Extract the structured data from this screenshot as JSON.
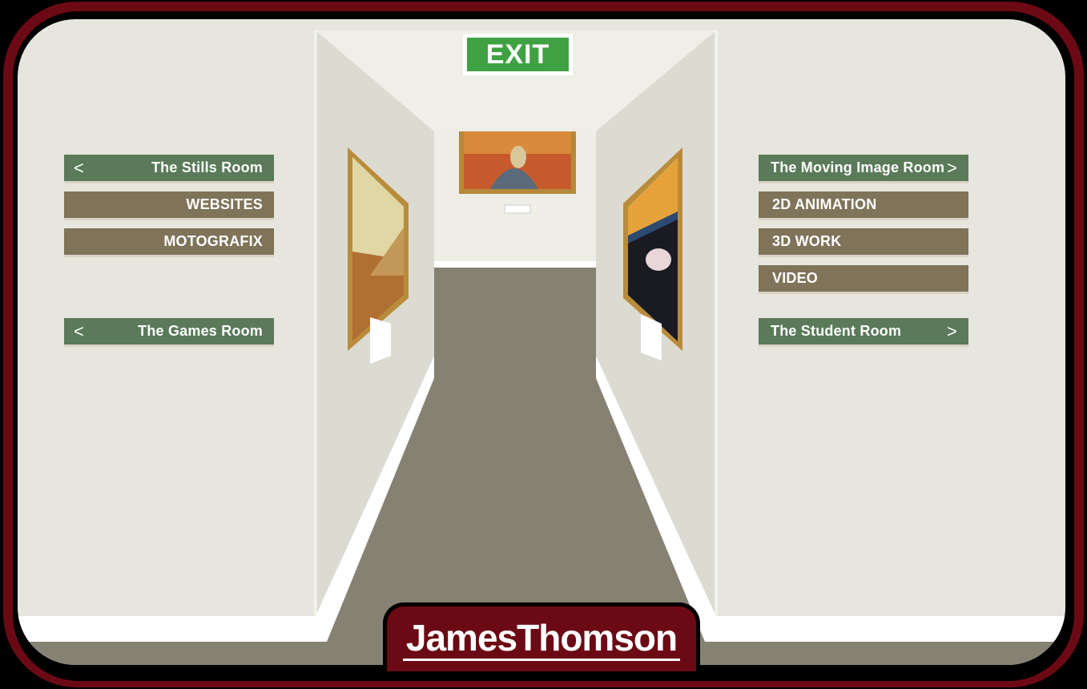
{
  "exit_sign": {
    "label": "EXIT"
  },
  "left_nav": {
    "stills_room": {
      "label": "The Stills Room",
      "arrow": "<"
    },
    "items": [
      {
        "label": "WEBSITES"
      },
      {
        "label": "MOTOGRAFIX"
      }
    ],
    "games_room": {
      "label": "The Games Room",
      "arrow": "<"
    }
  },
  "right_nav": {
    "moving_image_room": {
      "label": "The Moving Image Room",
      "arrow": ">"
    },
    "items": [
      {
        "label": "2D ANIMATION"
      },
      {
        "label": "3D WORK"
      },
      {
        "label": "VIDEO"
      }
    ],
    "student_room": {
      "label": "The Student Room",
      "arrow": ">"
    }
  },
  "footer": {
    "name": "JamesThomson"
  },
  "colors": {
    "frame": "#6b0a14",
    "room_button": "#5a7a5a",
    "category_button": "#7f7359",
    "exit_green": "#3fa142",
    "floor": "#858274",
    "wall": "#e7e6de"
  }
}
